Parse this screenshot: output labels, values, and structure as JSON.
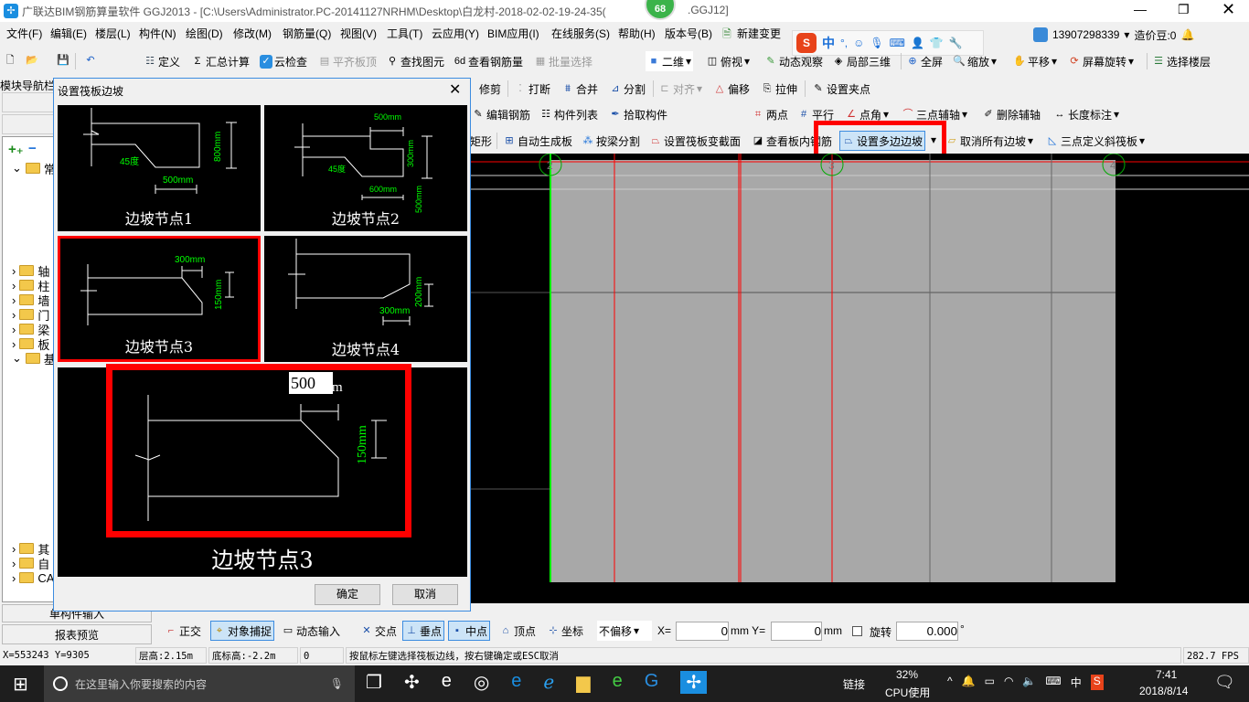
{
  "app": {
    "title": "广联达BIM钢筋算量软件 GGJ2013 - [C:\\Users\\Administrator.PC-20141127NRHM\\Desktop\\白龙村-2018-02-02-19-24-35(",
    "title_suffix": ".GGJ12]",
    "badge": "68"
  },
  "menu": [
    "文件(F)",
    "编辑(E)",
    "楼层(L)",
    "构件(N)",
    "绘图(D)",
    "修改(M)",
    "钢筋量(Q)",
    "视图(V)",
    "工具(T)",
    "云应用(Y)",
    "BIM应用(I)",
    "在线服务(S)",
    "帮助(H)",
    "版本号(B)",
    "新建变更"
  ],
  "menu_right": {
    "account": "13907298339",
    "beans": "造价豆:0",
    "ime": "中"
  },
  "toolbar1": {
    "left": [
      "定义",
      "汇总计算",
      "云检查",
      "平齐板顶",
      "查找图元",
      "查看钢筋量",
      "批量选择"
    ],
    "right": [
      "二维",
      "俯视",
      "动态观察",
      "局部三维",
      "全屏",
      "缩放",
      "平移",
      "屏幕旋转",
      "选择楼层"
    ]
  },
  "toolbar2": [
    "修剪",
    "打断",
    "合并",
    "分割",
    "对齐",
    "偏移",
    "拉伸",
    "设置夹点"
  ],
  "toolbar3": {
    "left": [
      "编辑钢筋",
      "构件列表",
      "拾取构件"
    ],
    "right": [
      "两点",
      "平行",
      "点角",
      "三点辅轴",
      "删除辅轴",
      "长度标注"
    ]
  },
  "toolbar4": [
    "矩形",
    "自动生成板",
    "按梁分割",
    "设置筏板变截面",
    "查看板内钢筋",
    "设置多边边坡",
    "取消所有边坡",
    "三点定义斜筏板"
  ],
  "nav": {
    "title": "模块导航栏",
    "tree": [
      "常",
      "轴",
      "柱",
      "墙",
      "门",
      "梁",
      "板",
      "基",
      "其",
      "自",
      "CA"
    ],
    "bottom": [
      "单构件输入",
      "报表预览"
    ]
  },
  "dialog": {
    "title": "设置筏板边坡",
    "tiles": [
      {
        "label": "边坡节点1",
        "dims": [
          "45度",
          "500mm",
          "800mm"
        ]
      },
      {
        "label": "边坡节点2",
        "dims": [
          "500mm",
          "300mm",
          "500mm",
          "45度",
          "600mm"
        ]
      },
      {
        "label": "边坡节点3",
        "dims": [
          "300mm",
          "150mm"
        ],
        "selected": true
      },
      {
        "label": "边坡节点4",
        "dims": [
          "200mm",
          "300mm"
        ]
      }
    ],
    "preview": {
      "label": "边坡节点3",
      "input_value": "500",
      "unit": "m",
      "vdim": "150mm"
    },
    "ok": "确定",
    "cancel": "取消"
  },
  "canvas": {
    "axes": [
      "2",
      "3",
      "4"
    ],
    "colors": {
      "bg": "#000000",
      "slab": "#a8a8a8",
      "beam": "#ff0000",
      "axis": "#00cc00"
    }
  },
  "snapbar": {
    "items": [
      "正交",
      "对象捕捉",
      "动态输入",
      "交点",
      "垂点",
      "中点",
      "顶点",
      "坐标"
    ],
    "offset": "不偏移",
    "x_label": "X=",
    "x": "0",
    "y_label": "mm Y=",
    "y": "0",
    "mm": "mm",
    "rotate": "旋转",
    "rotate_val": "0.000",
    "deg": "°"
  },
  "status": {
    "coords": "X=553243 Y=9305",
    "floor_h": "层高:2.15m",
    "base_h": "底标高:-2.2m",
    "zero": "0",
    "hint": "按鼠标左键选择筏板边线，按右键确定或ESC取消",
    "fps": "282.7 FPS"
  },
  "taskbar": {
    "search": "在这里输入你要搜索的内容",
    "net": "链接",
    "cpu": "32%",
    "cpu_label": "CPU使用",
    "ime": "中",
    "time": "7:41",
    "date": "2018/8/14"
  }
}
